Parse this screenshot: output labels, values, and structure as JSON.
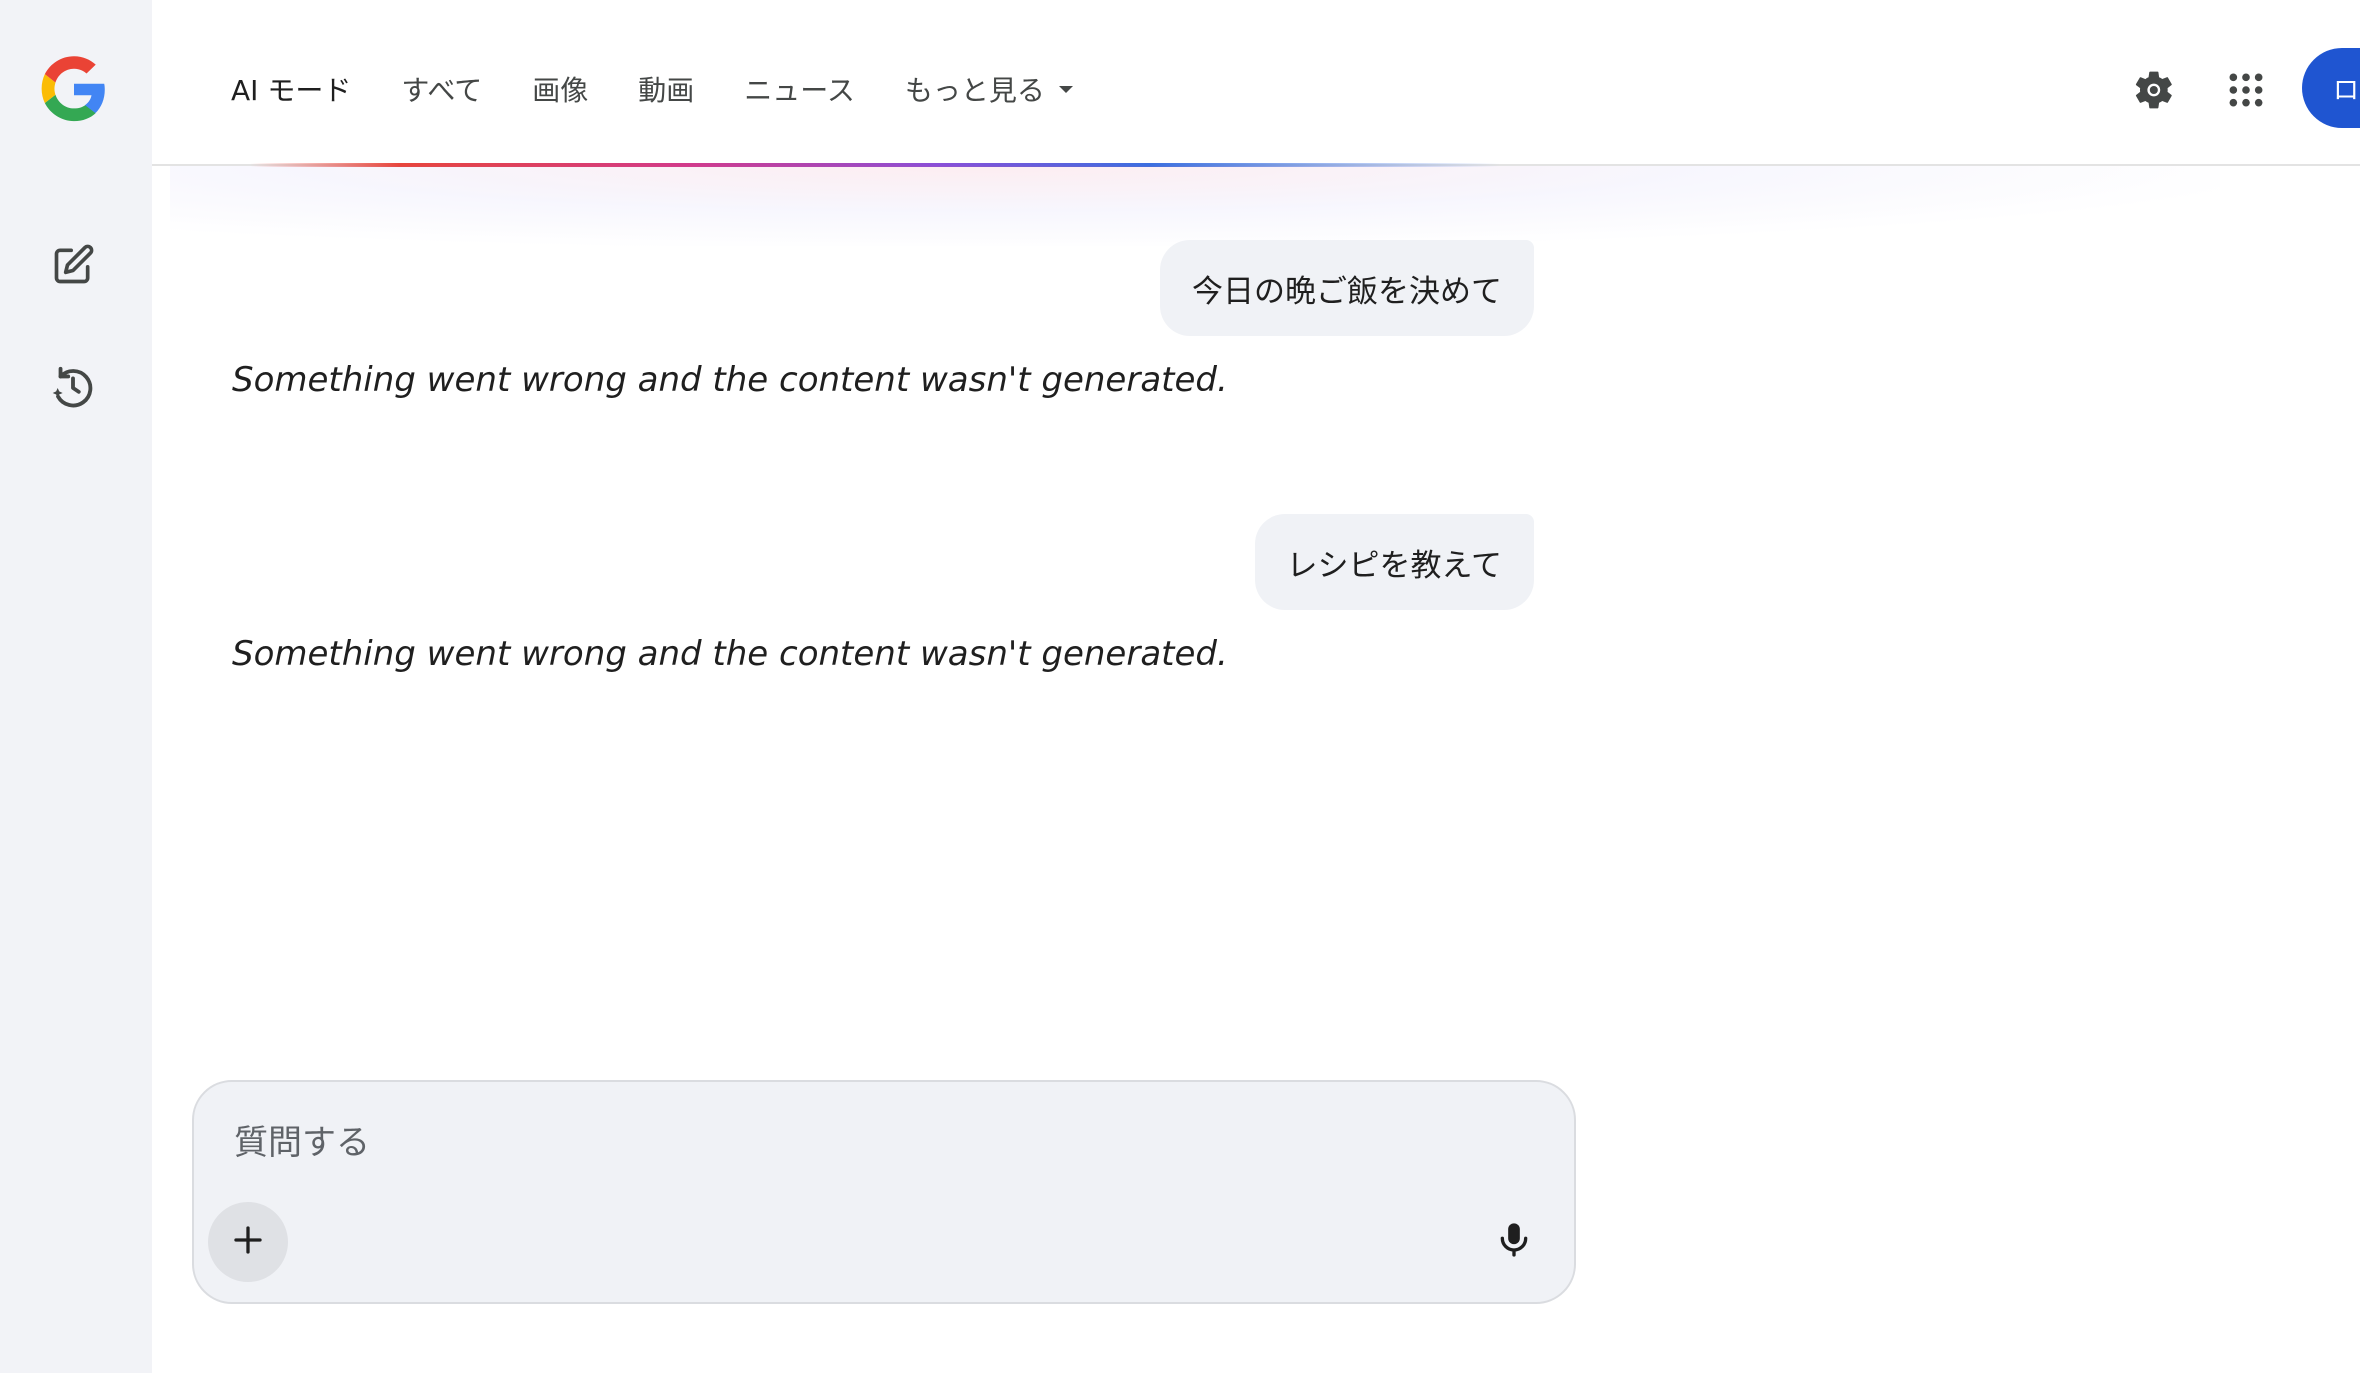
{
  "sidebar": {
    "logo_icon": "google-g-logo",
    "new_chat_icon": "edit-square-icon",
    "history_icon": "history-icon"
  },
  "header": {
    "tabs": [
      {
        "label": "AI モード",
        "active": true
      },
      {
        "label": "すべて",
        "active": false
      },
      {
        "label": "画像",
        "active": false
      },
      {
        "label": "動画",
        "active": false
      },
      {
        "label": "ニュース",
        "active": false
      },
      {
        "label": "もっと見る",
        "active": false,
        "has_dropdown": true
      }
    ],
    "settings_icon": "gear-icon",
    "apps_icon": "grid-apps-icon",
    "login_label": "ログイン",
    "accent_color": "#1f55d1"
  },
  "conversation": [
    {
      "user": "今日の晩ご飯を決めて",
      "response": "Something went wrong and the content wasn't generated."
    },
    {
      "user": "レシピを教えて",
      "response": "Something went wrong and the content wasn't generated."
    }
  ],
  "composer": {
    "placeholder": "質問する",
    "value": "",
    "plus_icon": "plus-icon",
    "mic_icon": "microphone-icon"
  }
}
